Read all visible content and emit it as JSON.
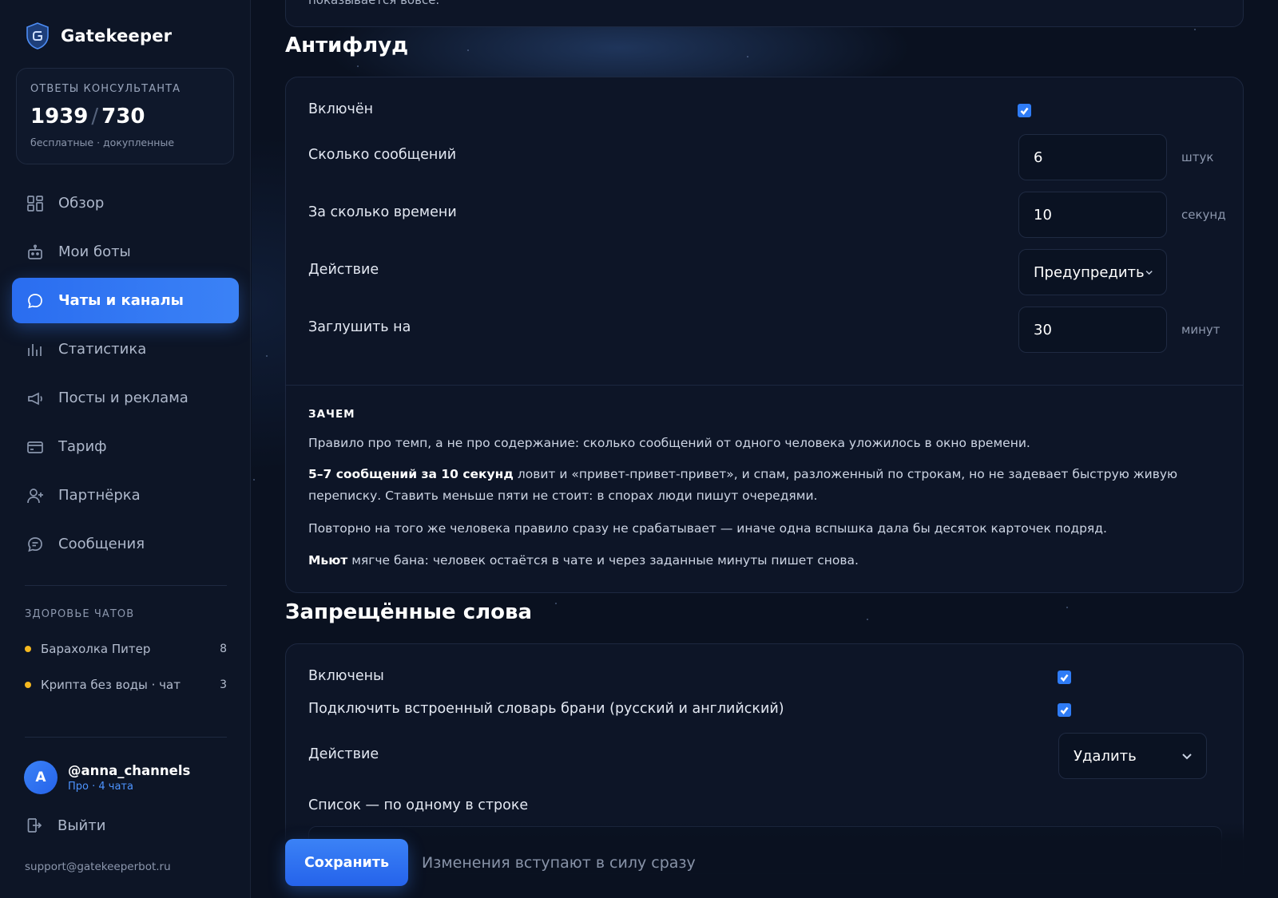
{
  "brand": {
    "name": "Gatekeeper"
  },
  "quota": {
    "title": "Ответы консультанта",
    "free": "1939",
    "separator": "/",
    "paid": "730",
    "subtitle": "бесплатные · докупленные"
  },
  "nav": [
    {
      "label": "Обзор",
      "icon": "dashboard-icon"
    },
    {
      "label": "Мои боты",
      "icon": "bot-icon"
    },
    {
      "label": "Чаты и каналы",
      "icon": "chat-bubble-icon",
      "active": true
    },
    {
      "label": "Статистика",
      "icon": "bar-chart-icon"
    },
    {
      "label": "Посты и реклама",
      "icon": "megaphone-icon"
    },
    {
      "label": "Тариф",
      "icon": "card-icon"
    },
    {
      "label": "Партнёрка",
      "icon": "user-plus-icon"
    },
    {
      "label": "Сообщения",
      "icon": "message-icon"
    }
  ],
  "health": {
    "title": "Здоровье чатов",
    "items": [
      {
        "name": "Барахолка Питер",
        "count": "8"
      },
      {
        "name": "Крипта без воды · чат",
        "count": "3"
      }
    ]
  },
  "user": {
    "initial": "A",
    "handle": "@anna_channels",
    "plan": "Про · 4 чата"
  },
  "logout_label": "Выйти",
  "support_email": "support@gatekeeperbot.ru",
  "prev_card_text": "показывается вовсе.",
  "antiflood": {
    "title": "Антифлуд",
    "enabled_label": "Включён",
    "enabled": true,
    "messages_label": "Сколько сообщений",
    "messages_value": "6",
    "messages_unit": "штук",
    "time_label": "За сколько времени",
    "time_value": "10",
    "time_unit": "секунд",
    "action_label": "Действие",
    "action_value": "Предупредить",
    "mute_label": "Заглушить на",
    "mute_value": "30",
    "mute_unit": "минут",
    "why_title": "Зачем",
    "p1": "Правило про темп, а не про содержание: сколько сообщений от одного человека уложилось в окно времени.",
    "p2_bold": "5–7 сообщений за 10 секунд",
    "p2_rest": " ловит и «привет-привет-привет», и спам, разложенный по строкам, но не задевает быструю живую переписку. Ставить меньше пяти не стоит: в спорах люди пишут очередями.",
    "p3": "Повторно на того же человека правило сразу не срабатывает — иначе одна вспышка дала бы десяток карточек подряд.",
    "p4_bold": "Мьют",
    "p4_rest": " мягче бана: человек остаётся в чате и через заданные минуты пишет снова."
  },
  "banned_words": {
    "title": "Запрещённые слова",
    "enabled_label": "Включены",
    "enabled": true,
    "dict_label": "Подключить встроенный словарь брани (русский и английский)",
    "dict_enabled": true,
    "action_label": "Действие",
    "action_value": "Удалить",
    "list_label": "Список — по одному в строке"
  },
  "save": {
    "button": "Сохранить",
    "note": "Изменения вступают в силу сразу"
  },
  "colors": {
    "accent": "#3b82f6",
    "health_dot": "#f5b81f",
    "background": "#0a1120"
  }
}
